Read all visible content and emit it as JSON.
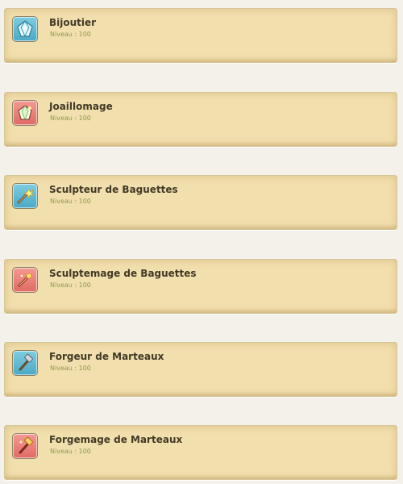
{
  "professions": [
    {
      "name": "Bijoutier",
      "level_text": "Niveau : 100",
      "icon": "gem-icon"
    },
    {
      "name": "Joaillomage",
      "level_text": "Niveau : 100",
      "icon": "gem-magic-icon"
    },
    {
      "name": "Sculpteur de Baguettes",
      "level_text": "Niveau : 100",
      "icon": "wand-carving-icon"
    },
    {
      "name": "Sculptemage de Baguettes",
      "level_text": "Niveau : 100",
      "icon": "wand-magic-icon"
    },
    {
      "name": "Forgeur de Marteaux",
      "level_text": "Niveau : 100",
      "icon": "hammer-forging-icon"
    },
    {
      "name": "Forgemage de Marteaux",
      "level_text": "Niveau : 100",
      "icon": "hammer-magic-icon"
    }
  ],
  "colors": {
    "card_background": "#f2dfae",
    "title_text": "#433a25",
    "level_text": "#8f9a4a",
    "icon_teal": "#4aa9c4",
    "icon_red": "#e06a64"
  }
}
